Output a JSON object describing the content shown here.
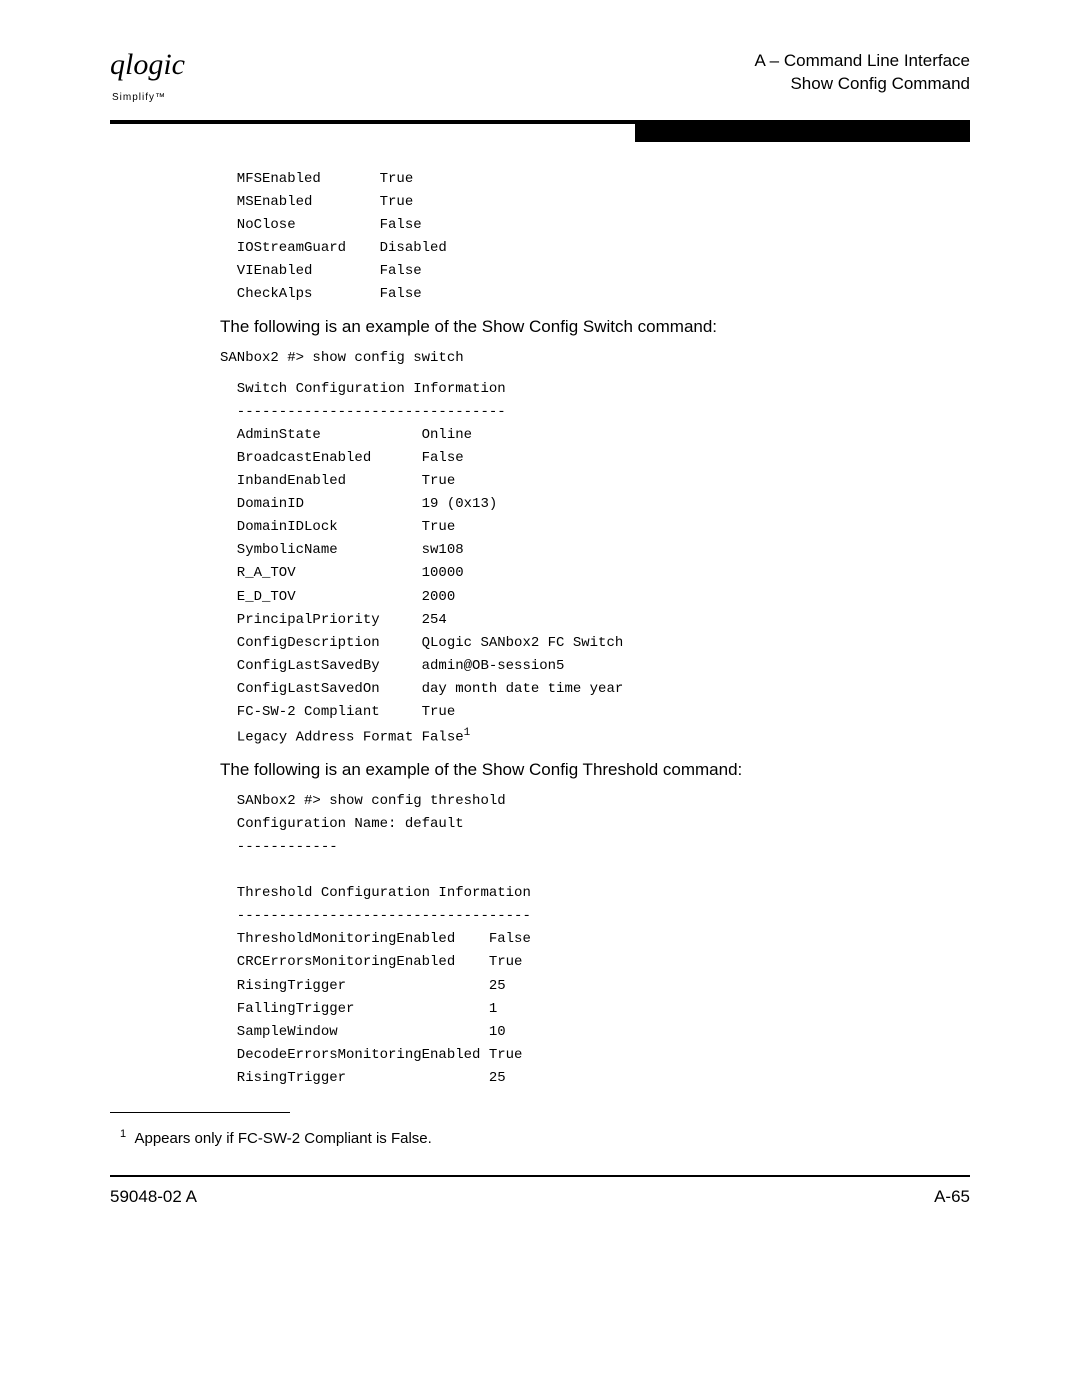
{
  "header": {
    "logo_main": "qlogic",
    "logo_sub": "Simplify™",
    "line1": "A – Command Line Interface",
    "line2": "Show Config Command"
  },
  "block1": "  MFSEnabled       True\n  MSEnabled        True\n  NoClose          False\n  IOStreamGuard    Disabled\n  VIEnabled        False\n  CheckAlps        False",
  "para1": "The following is an example of the Show Config Switch command:",
  "block2_cmd": "SANbox2 #> show config switch",
  "block2_body": "  Switch Configuration Information\n  --------------------------------\n  AdminState            Online\n  BroadcastEnabled      False\n  InbandEnabled         True\n  DomainID              19 (0x13)\n  DomainIDLock          True\n  SymbolicName          sw108\n  R_A_TOV               10000\n  E_D_TOV               2000\n  PrincipalPriority     254\n  ConfigDescription     QLogic SANbox2 FC Switch\n  ConfigLastSavedBy     admin@OB-session5\n  ConfigLastSavedOn     day month date time year\n  FC-SW-2 Compliant     True\n  Legacy Address Format False",
  "block2_sup": "1",
  "para2": "The following is an example of the Show Config Threshold command:",
  "block3": "  SANbox2 #> show config threshold\n  Configuration Name: default\n  ------------\n\n  Threshold Configuration Information\n  -----------------------------------\n  ThresholdMonitoringEnabled    False\n  CRCErrorsMonitoringEnabled    True\n  RisingTrigger                 25\n  FallingTrigger                1\n  SampleWindow                  10\n  DecodeErrorsMonitoringEnabled True\n  RisingTrigger                 25",
  "footnote": {
    "marker": "1",
    "text": "Appears only if FC-SW-2 Compliant is False."
  },
  "footer": {
    "left": "59048-02 A",
    "right": "A-65"
  }
}
